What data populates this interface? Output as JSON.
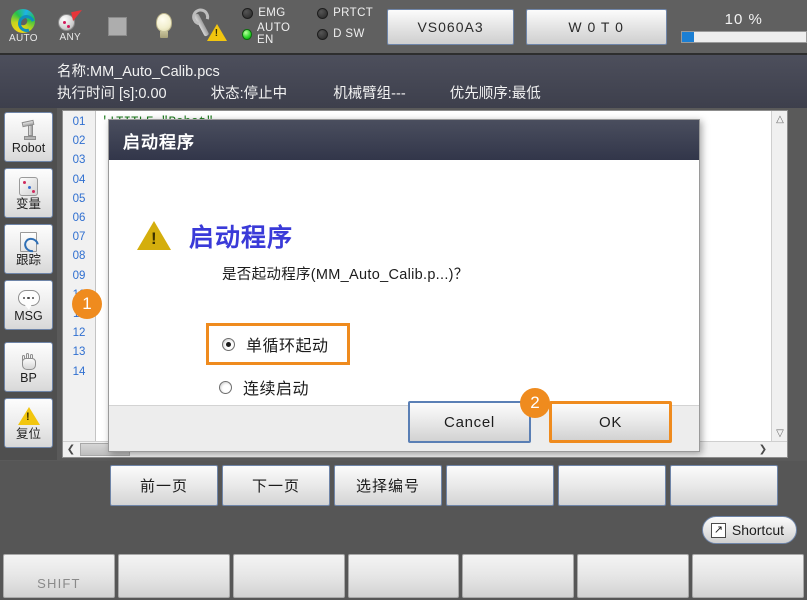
{
  "toolbar": {
    "mode_icon_label": "AUTO",
    "any_icon_label": "ANY",
    "leds": [
      {
        "name": "EMG",
        "on": false
      },
      {
        "name": "PRTCT",
        "on": false
      },
      {
        "name": "AUTO EN",
        "on": true
      },
      {
        "name": "D SW",
        "on": false
      }
    ],
    "model_button": "VS060A3",
    "tool_button": "W 0 T 0",
    "speed_value": "10 %",
    "speed_percent": 10
  },
  "infobar": {
    "name_label": "名称:MM_Auto_Calib.pcs",
    "exec_time": "执行时间 [s]:0.00",
    "status": "状态:停止中",
    "arm_group": "机械臂组---",
    "priority": "优先顺序:最低"
  },
  "sidebar": {
    "items": [
      {
        "label": "Robot",
        "icon": "robot-icon"
      },
      {
        "label": "变量",
        "icon": "variable-dice-icon"
      },
      {
        "label": "跟踪",
        "icon": "trace-document-icon"
      },
      {
        "label": "MSG",
        "icon": "message-bubble-icon"
      },
      {
        "label": "BP",
        "icon": "hand-breakpoint-icon"
      },
      {
        "label": "复位",
        "icon": "warning-triangle-icon"
      }
    ]
  },
  "editor": {
    "line_numbers": [
      "01",
      "02",
      "03",
      "04",
      "05",
      "06",
      "07",
      "08",
      "09",
      "10",
      "11",
      "12",
      "13",
      "14"
    ],
    "code_lines": [
      "'!TITLE \"Robot\""
    ]
  },
  "dialog": {
    "title": "启动程序",
    "heading": "启动程序",
    "message": "是否起动程序(MM_Auto_Calib.p...)？",
    "options": [
      {
        "label": "单循环起动",
        "selected": true,
        "highlight": true
      },
      {
        "label": "连续启动",
        "selected": false,
        "highlight": false
      }
    ],
    "cancel_label": "Cancel",
    "ok_label": "OK",
    "badges": [
      {
        "number": "1"
      },
      {
        "number": "2"
      }
    ],
    "highlight_color": "#ef8b1e",
    "heading_color": "#3a3ad8"
  },
  "function_keys": [
    {
      "label": "前一页"
    },
    {
      "label": "下一页"
    },
    {
      "label": "选择编号"
    },
    {
      "label": ""
    },
    {
      "label": ""
    },
    {
      "label": ""
    }
  ],
  "shortcut": {
    "label": "Shortcut",
    "icon": "shortcut-arrow-icon"
  },
  "bottom_keys": [
    {
      "label": "SHIFT"
    },
    {
      "label": ""
    },
    {
      "label": ""
    },
    {
      "label": ""
    },
    {
      "label": ""
    },
    {
      "label": ""
    },
    {
      "label": ""
    }
  ]
}
